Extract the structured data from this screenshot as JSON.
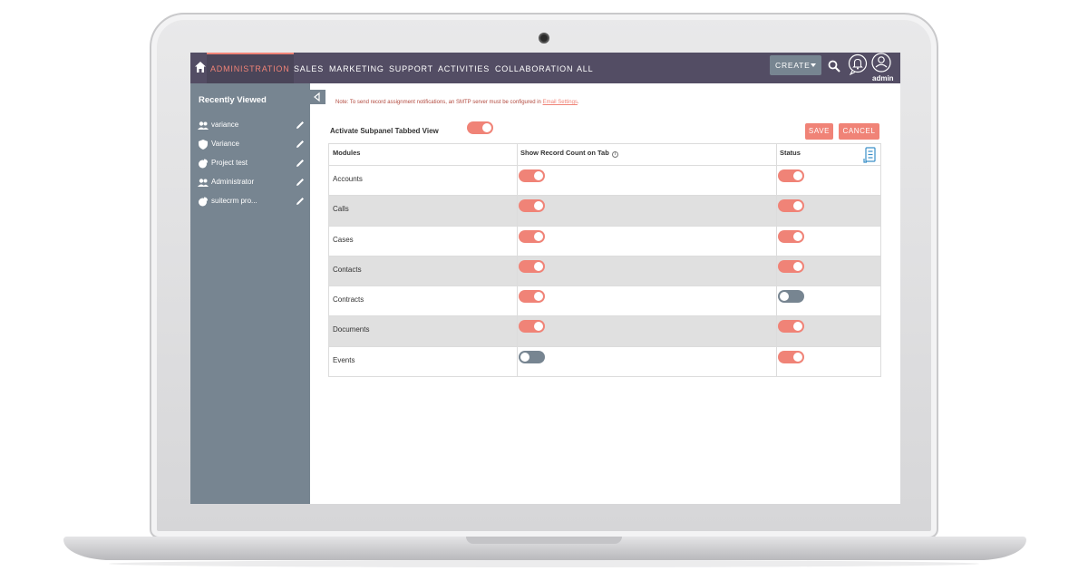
{
  "nav": {
    "tabs": [
      {
        "label": "ADMINISTRATION",
        "active": true
      },
      {
        "label": "SALES"
      },
      {
        "label": "MARKETING"
      },
      {
        "label": "SUPPORT"
      },
      {
        "label": "ACTIVITIES"
      },
      {
        "label": "COLLABORATION"
      },
      {
        "label": "ALL"
      }
    ],
    "create_label": "CREATE",
    "user_label": "admin"
  },
  "sidebar": {
    "title": "Recently Viewed",
    "items": [
      {
        "label": "variance",
        "icon": "users-icon"
      },
      {
        "label": "Variance",
        "icon": "shield-icon"
      },
      {
        "label": "Project test",
        "icon": "pie-chart-icon"
      },
      {
        "label": "Administrator",
        "icon": "users-icon"
      },
      {
        "label": "suitecrm pro...",
        "icon": "pie-chart-icon"
      }
    ]
  },
  "main": {
    "note_text": "Note: To send record assignment notifications, an SMTP server must be configured in ",
    "note_link": "Email Settings",
    "note_end": ".",
    "activate_label": "Activate Subpanel Tabbed View",
    "activate_on": true,
    "save_label": "SAVE",
    "cancel_label": "CANCEL",
    "columns": [
      "Modules",
      "Show Record Count on Tab",
      "Status"
    ],
    "rows": [
      {
        "module": "Accounts",
        "count_on": true,
        "status_on": true
      },
      {
        "module": "Calls",
        "count_on": true,
        "status_on": true
      },
      {
        "module": "Cases",
        "count_on": true,
        "status_on": true
      },
      {
        "module": "Contacts",
        "count_on": true,
        "status_on": true
      },
      {
        "module": "Contracts",
        "count_on": true,
        "status_on": false
      },
      {
        "module": "Documents",
        "count_on": true,
        "status_on": true
      },
      {
        "module": "Events",
        "count_on": false,
        "status_on": true
      }
    ]
  },
  "colors": {
    "nav_bg": "#534d64",
    "accent": "#f08377",
    "sidebar_bg": "#778591",
    "toggle_off": "#778591"
  }
}
